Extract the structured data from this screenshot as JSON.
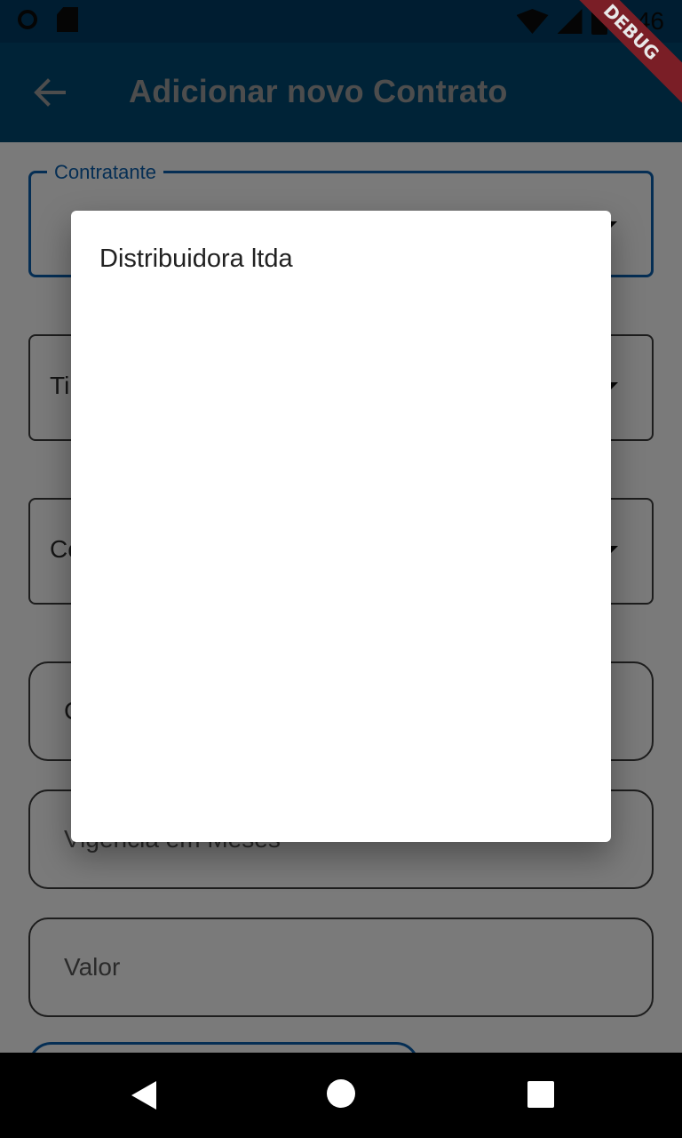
{
  "status_bar": {
    "time": "8:46",
    "icons": [
      "sync-icon",
      "sd-card-icon",
      "wifi-icon",
      "signal-icon",
      "battery-icon"
    ]
  },
  "app_bar": {
    "title": "Adicionar novo Contrato",
    "back_icon": "arrow-back-icon",
    "debug_banner": "DEBUG"
  },
  "form": {
    "contratante": {
      "label": "Contratante",
      "value": ""
    },
    "field_2": {
      "visible_text": "Ti"
    },
    "field_3": {
      "visible_text": "Co"
    },
    "field_4": {
      "visible_text": "C"
    },
    "vigencia": {
      "placeholder": "Vigência em Meses"
    },
    "valor": {
      "placeholder": "Valor"
    }
  },
  "dialog": {
    "options": [
      "Distribuidora ltda"
    ]
  },
  "nav_bar": {
    "icons": [
      "nav-back-icon",
      "nav-home-icon",
      "nav-recents-icon"
    ]
  },
  "colors": {
    "app_bar": "#01466f",
    "status_bar": "#013a63",
    "focus_border": "#0a5ca8",
    "debug_ribbon": "#7a1e26"
  }
}
